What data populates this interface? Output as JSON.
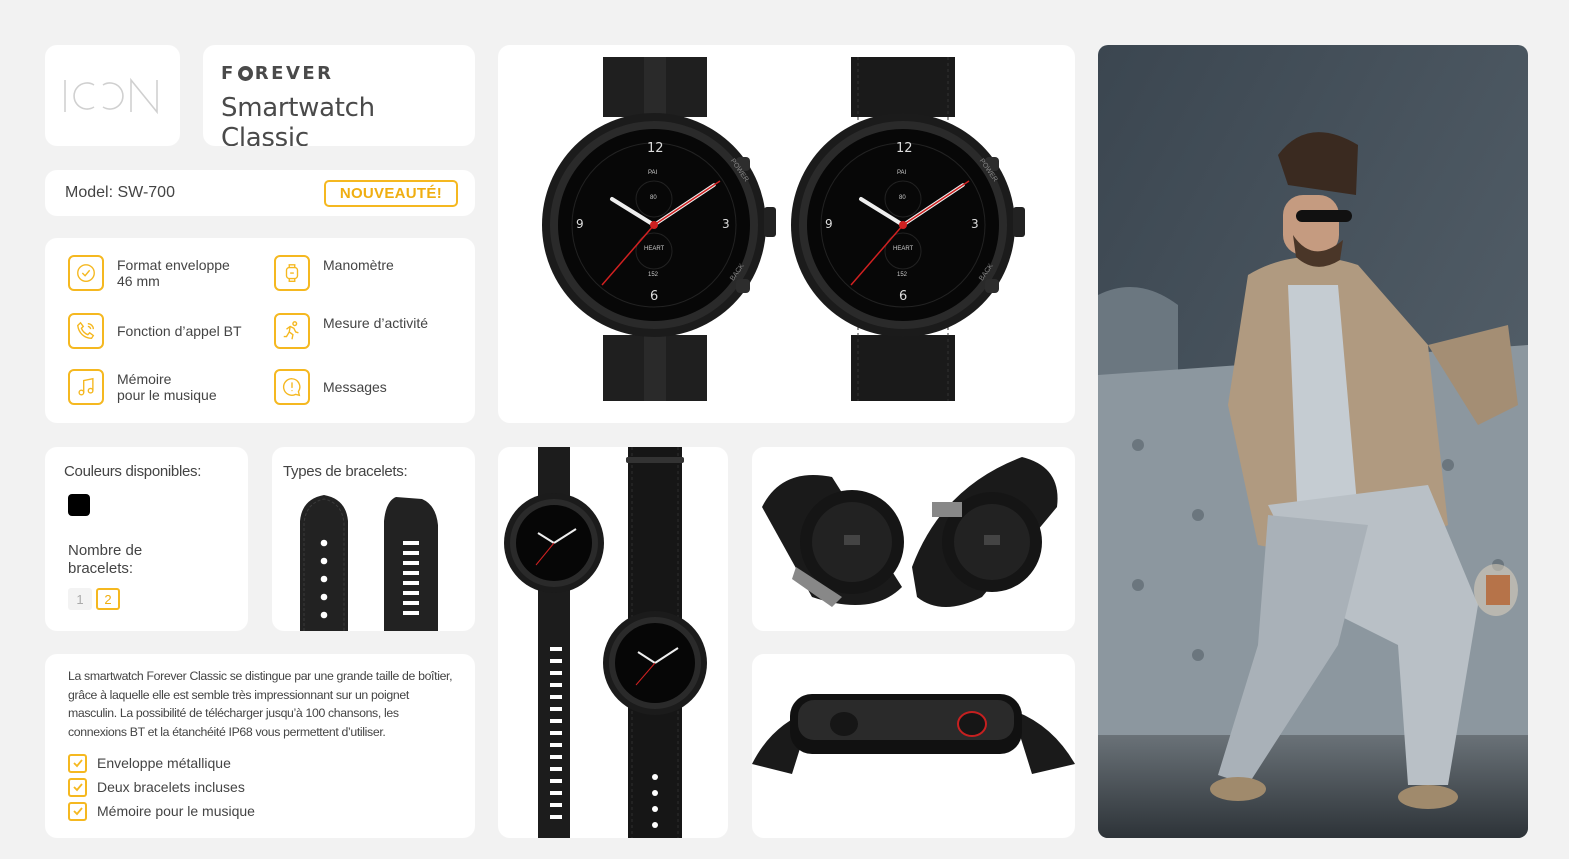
{
  "logo": {
    "text": "ICON",
    "name": "icon-logo"
  },
  "header": {
    "brand": "FOREVER",
    "title": "Smartwatch Classic"
  },
  "model": {
    "label": "Model: SW-700",
    "badge": "NOUVEAUTÉ!"
  },
  "features": [
    {
      "label": "Format enveloppe\n46 mm",
      "icon": "watch-check-icon"
    },
    {
      "label": "Manomètre",
      "icon": "watch-gauge-icon"
    },
    {
      "label": "Fonction d’appel BT",
      "icon": "phone-call-icon"
    },
    {
      "label": "Mesure d’activité",
      "icon": "running-icon"
    },
    {
      "label": "Mémoire\npour le musique",
      "icon": "music-note-icon"
    },
    {
      "label": "Messages",
      "icon": "message-icon"
    }
  ],
  "colors": {
    "title": "Couleurs disponibles:",
    "swatches": [
      "#000000"
    ],
    "count_title": "Nombre de\nbracelets:",
    "count_options": [
      "1",
      "2"
    ],
    "count_selected": "2"
  },
  "straps": {
    "title": "Types de bracelets:"
  },
  "description": {
    "text": "La smartwatch Forever Classic se distingue par une grande taille de boîtier, grâce à laquelle elle est semble très impressionnant sur un poignet masculin. La possibilité de télécharger jusqu’à 100 chansons, les connexions BT et la étanchéité IP68 vous permettent d’utiliser.",
    "checks": [
      "Enveloppe métallique",
      "Deux bracelets incluses",
      "Mémoire pour le musique"
    ]
  },
  "watch_face": {
    "top": "12",
    "bottom": "6",
    "left": "9",
    "right": "3",
    "pai": "PAI",
    "pai_value": "80",
    "heart": "HEART",
    "heart_value": "152",
    "power": "POWER",
    "back": "BACK"
  },
  "colors_theme": {
    "accent": "#f5b820",
    "text": "#444444",
    "background": "#f2f2f2"
  }
}
